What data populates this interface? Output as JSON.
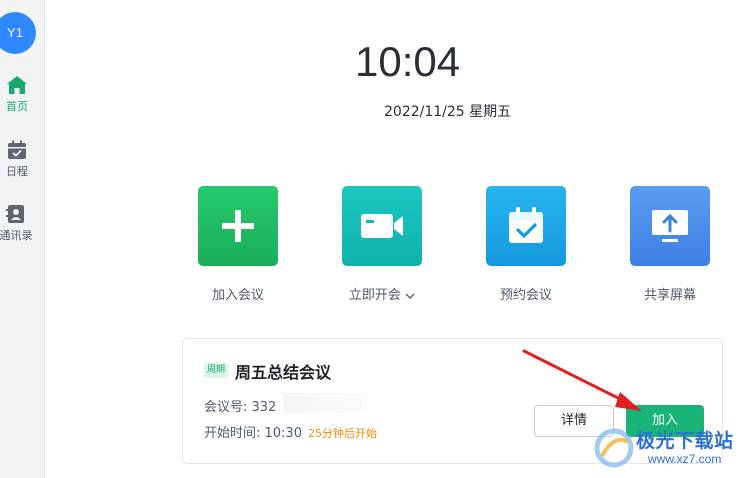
{
  "sidebar": {
    "avatar_text": "Y1",
    "items": [
      {
        "label": "首页",
        "icon": "home-icon",
        "active": true
      },
      {
        "label": "日程",
        "icon": "calendar-icon",
        "active": false
      },
      {
        "label": "通讯录",
        "icon": "contacts-icon",
        "active": false
      }
    ]
  },
  "clock": {
    "time": "10:04",
    "date": "2022/11/25 星期五"
  },
  "actions": [
    {
      "label": "加入会议",
      "icon": "plus-icon"
    },
    {
      "label": "立即开会",
      "icon": "video-camera-icon",
      "dropdown_icon": "chevron-down-icon"
    },
    {
      "label": "预约会议",
      "icon": "calendar-check-icon"
    },
    {
      "label": "共享屏幕",
      "icon": "screen-share-icon"
    }
  ],
  "meeting_card": {
    "tag": "周期",
    "title": "周五总结会议",
    "meeting_id_label": "会议号: 332",
    "start_time_label": "开始时间: 10:30",
    "countdown": "25分钟后开始",
    "details_button": "详情",
    "join_button": "加入"
  },
  "watermark": {
    "text": "极光下载站",
    "url": "www.xz7.com"
  },
  "colors": {
    "accent_green": "#17b377",
    "avatar_blue": "#2f88ff",
    "annotation_red": "#e02020",
    "countdown_orange": "#f08a00"
  }
}
